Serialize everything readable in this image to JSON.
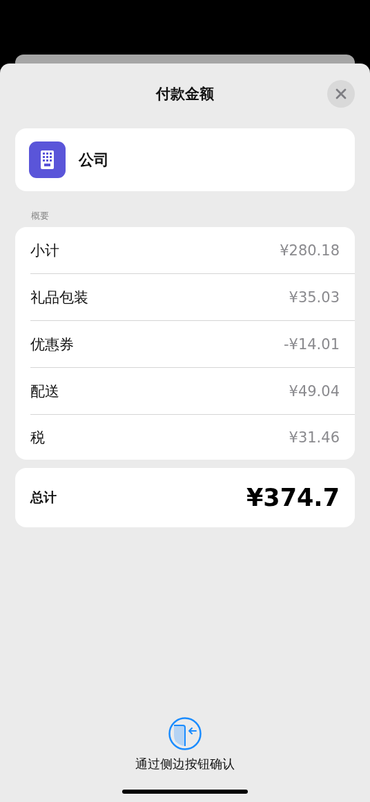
{
  "sheet": {
    "title": "付款金额"
  },
  "payee": {
    "name": "公司"
  },
  "summary": {
    "header": "概要",
    "rows": [
      {
        "label": "小计",
        "amount": "¥280.18"
      },
      {
        "label": "礼品包装",
        "amount": "¥35.03"
      },
      {
        "label": "优惠券",
        "amount": "-¥14.01"
      },
      {
        "label": "配送",
        "amount": "¥49.04"
      },
      {
        "label": "税",
        "amount": "¥31.46"
      }
    ]
  },
  "total": {
    "label": "总计",
    "amount": "¥374.7"
  },
  "confirm": {
    "hint": "通过侧边按钮确认"
  }
}
